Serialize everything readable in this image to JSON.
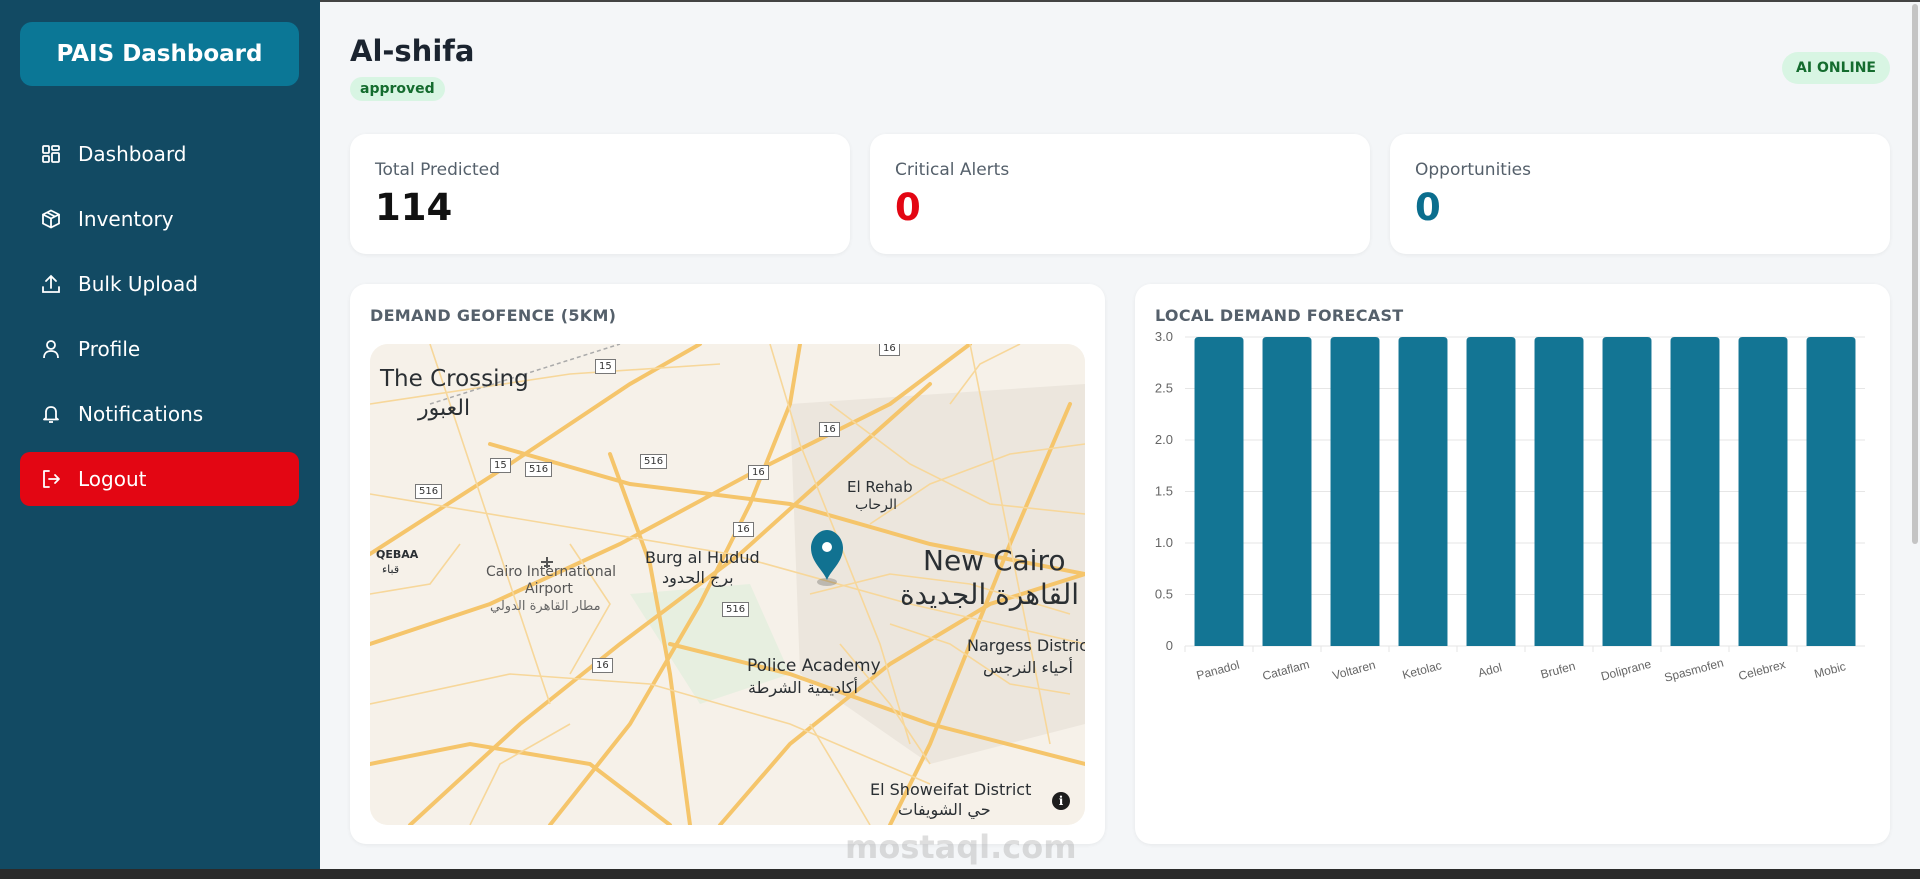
{
  "sidebar": {
    "brand": "PAIS Dashboard",
    "items": [
      {
        "label": "Dashboard",
        "icon": "dashboard-grid-icon"
      },
      {
        "label": "Inventory",
        "icon": "box-icon"
      },
      {
        "label": "Bulk Upload",
        "icon": "upload-icon"
      },
      {
        "label": "Profile",
        "icon": "user-icon"
      },
      {
        "label": "Notifications",
        "icon": "bell-icon"
      },
      {
        "label": "Logout",
        "icon": "logout-icon"
      }
    ]
  },
  "header": {
    "title": "Al-shifa",
    "status_badge": "approved",
    "ai_status": "AI ONLINE"
  },
  "stats": [
    {
      "label": "Total Predicted",
      "value": "114",
      "color": "#111111"
    },
    {
      "label": "Critical Alerts",
      "value": "0",
      "color": "#e30613"
    },
    {
      "label": "Opportunities",
      "value": "0",
      "color": "#0b6e8e"
    }
  ],
  "map_panel": {
    "title": "DEMAND GEOFENCE (5KM)",
    "labels": {
      "crossing_en": "The Crossing",
      "crossing_ar": "العبور",
      "el_rehab_en": "El Rehab",
      "el_rehab_ar": "الرحاب",
      "qebaa_en": "QEBAA",
      "qebaa_ar": "قباء",
      "airport_en_1": "Cairo International",
      "airport_en_2": "Airport",
      "airport_ar": "مطار القاهرة الدولي",
      "burg_en": "Burg al Hudud",
      "burg_ar": "برج الحدود",
      "new_cairo_en": "New Cairo",
      "new_cairo_ar": "القاهرة الجديدة",
      "nargess_en": "Nargess Distric",
      "nargess_ar": "أحياء النرجس",
      "police_en": "Police Academy",
      "police_ar": "أكاديمية الشرطة",
      "showeifat_en": "El Showeifat District",
      "showeifat_ar": "حي الشويفات"
    },
    "road_shields": [
      "15",
      "16",
      "15",
      "516",
      "516",
      "516",
      "16",
      "16",
      "16",
      "516",
      "16",
      "16"
    ],
    "info": "i"
  },
  "forecast_panel": {
    "title": "LOCAL DEMAND FORECAST"
  },
  "chart_data": {
    "type": "bar",
    "categories": [
      "Panadol",
      "Cataflam",
      "Voltaren",
      "Ketolac",
      "Adol",
      "Brufen",
      "Doliprane",
      "Spasmofen",
      "Celebrex",
      "Mobic"
    ],
    "values": [
      3,
      3,
      3,
      3,
      3,
      3,
      3,
      3,
      3,
      3
    ],
    "ylim": [
      0,
      3.0
    ],
    "yticks": [
      "0",
      "0.5",
      "1.0",
      "1.5",
      "2.0",
      "2.5",
      "3.0"
    ],
    "bar_color": "#137594",
    "grid": true
  },
  "watermark": "mostaql.com"
}
